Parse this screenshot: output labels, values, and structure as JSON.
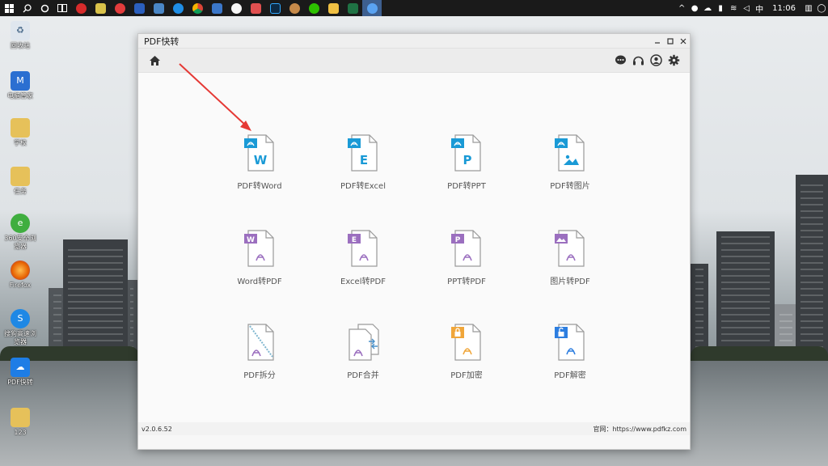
{
  "taskbar": {
    "time": "11:06",
    "ime": "中"
  },
  "desktop": {
    "icons": [
      {
        "label": "回收站",
        "color": "#8fa7c0"
      },
      {
        "label": "电脑管家",
        "color": "#2b6fd1"
      },
      {
        "label": "学校",
        "color": "#e6c15a"
      },
      {
        "label": "任务",
        "color": "#e6c15a"
      },
      {
        "label": "360安全浏览器",
        "color": "#3fae3f"
      },
      {
        "label": "Firefox",
        "color": "#e66000"
      },
      {
        "label": "搜狗高速浏览器",
        "color": "#1e88e5"
      },
      {
        "label": "PDF快转",
        "color": "#1e7de6"
      },
      {
        "label": "123",
        "color": "#e6c15a"
      }
    ]
  },
  "window": {
    "title": "PDF快转",
    "version": "v2.0.6.52",
    "website": "官网：https://www.pdfkz.com"
  },
  "features": [
    {
      "label": "PDF转Word",
      "letter": "W",
      "theme": "#1a9ad6",
      "badge": "pdf"
    },
    {
      "label": "PDF转Excel",
      "letter": "E",
      "theme": "#1a9ad6",
      "badge": "pdf"
    },
    {
      "label": "PDF转PPT",
      "letter": "P",
      "theme": "#1a9ad6",
      "badge": "pdf"
    },
    {
      "label": "PDF转图片",
      "letter": "",
      "theme": "#1a9ad6",
      "badge": "pdf"
    },
    {
      "label": "Word转PDF",
      "letter": "W",
      "theme": "#9b6fbf",
      "badge": "word"
    },
    {
      "label": "Excel转PDF",
      "letter": "E",
      "theme": "#9b6fbf",
      "badge": "excel"
    },
    {
      "label": "PPT转PDF",
      "letter": "P",
      "theme": "#9b6fbf",
      "badge": "ppt"
    },
    {
      "label": "图片转PDF",
      "letter": "",
      "theme": "#9b6fbf",
      "badge": "image"
    },
    {
      "label": "PDF拆分",
      "letter": "",
      "theme": "#7fb6cf",
      "badge": "split"
    },
    {
      "label": "PDF合并",
      "letter": "",
      "theme": "#4a90c9",
      "badge": "merge"
    },
    {
      "label": "PDF加密",
      "letter": "",
      "theme": "#f0a63a",
      "badge": "lock"
    },
    {
      "label": "PDF解密",
      "letter": "",
      "theme": "#2d7ee0",
      "badge": "unlock"
    }
  ],
  "colors": {
    "accent_blue": "#1a9ad6",
    "accent_purple": "#9b6fbf",
    "arrow": "#e53935"
  }
}
